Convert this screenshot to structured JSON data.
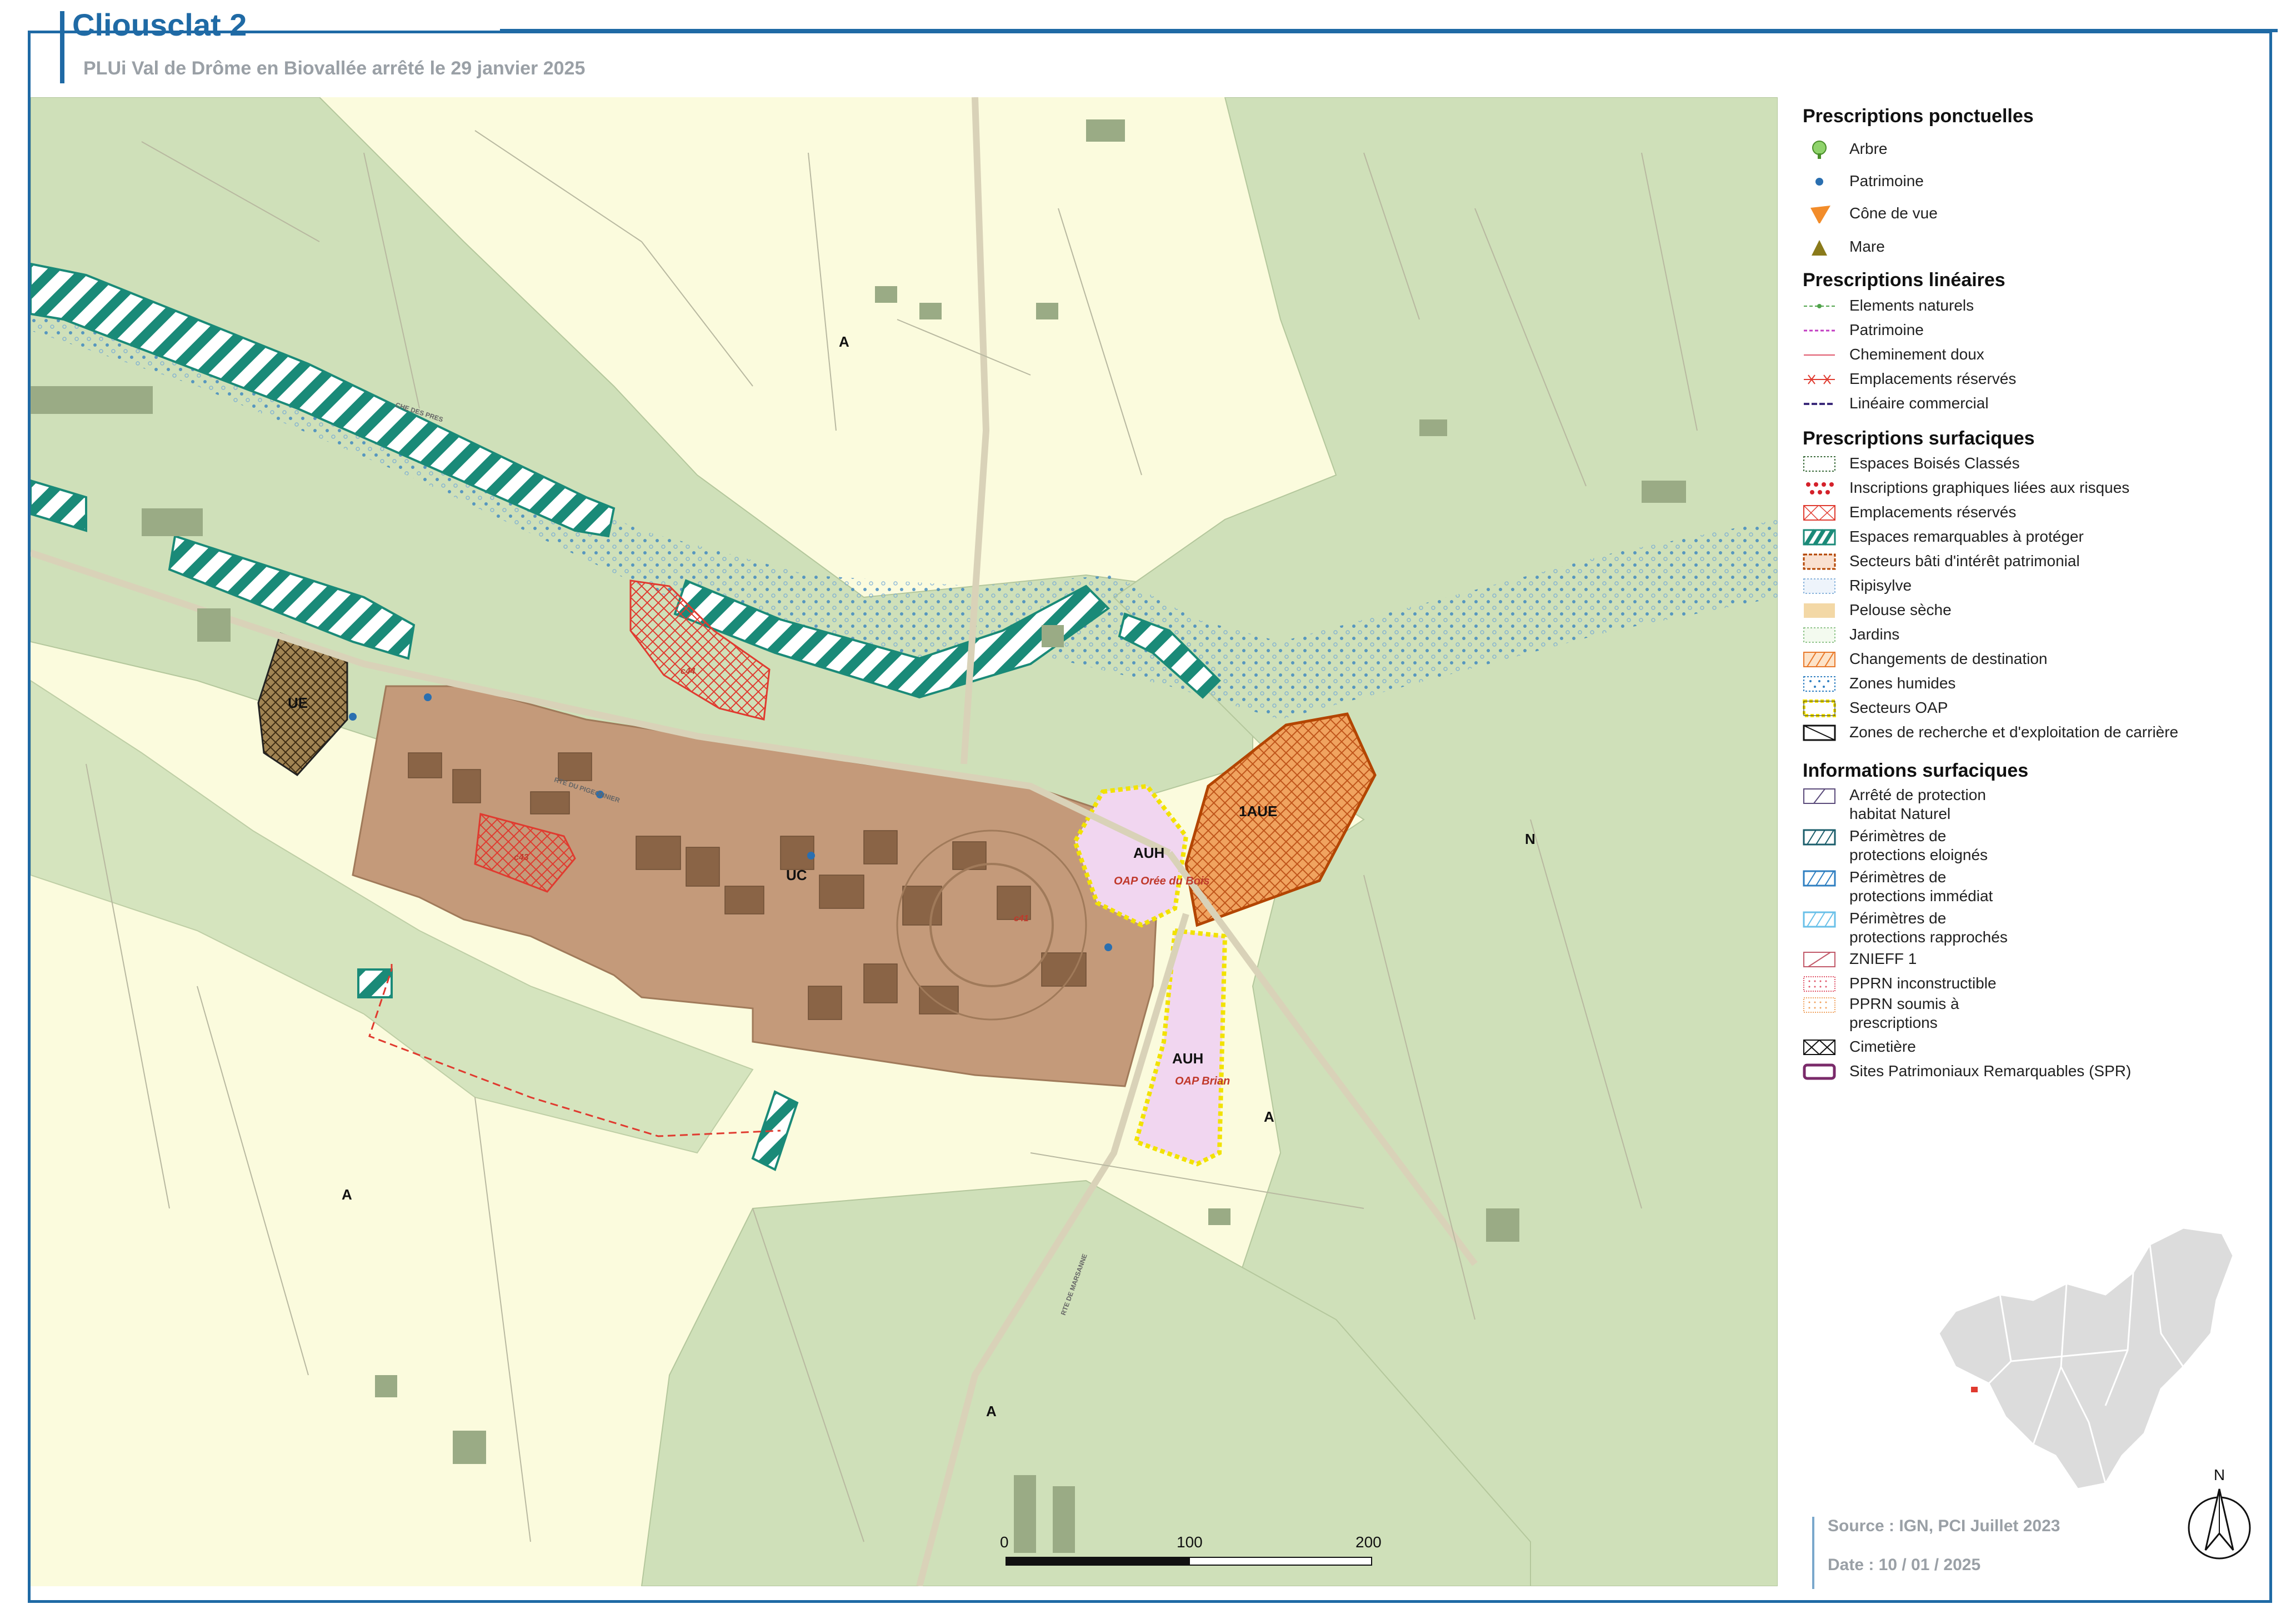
{
  "header": {
    "title": "Cliousclat 2",
    "subtitle": "PLUi Val de Drôme en Biovallée arrêté le 29 janvier 2025"
  },
  "map": {
    "zones": {
      "a1": "A",
      "a2": "A",
      "a3": "A",
      "a4": "A",
      "n": "N",
      "ue1": "UE",
      "ue2": "1AUE",
      "uc": "UC",
      "auh1": "AUH",
      "auh2": "AUH"
    },
    "oap": {
      "oree": "OAP Orée du Bois",
      "brian": "OAP Brian"
    },
    "er": {
      "c44": "c44",
      "c43": "c43",
      "c41": "c41"
    },
    "roads": {
      "che_pres": "CHE DES PRES",
      "route_pigeonnier": "RTE DU PIGEONNIER",
      "rte_marsanne": "RTE DE MARSANNE"
    }
  },
  "legend": {
    "ponctuelles": {
      "title": "Prescriptions ponctuelles",
      "items": [
        "Arbre",
        "Patrimoine",
        "Cône de vue",
        "Mare"
      ]
    },
    "lineaires": {
      "title": "Prescriptions linéaires",
      "items": [
        "Elements naturels",
        "Patrimoine",
        "Cheminement doux",
        "Emplacements réservés",
        "Linéaire commercial"
      ]
    },
    "surfaciques": {
      "title": "Prescriptions surfaciques",
      "items": [
        "Espaces Boisés Classés",
        "Inscriptions graphiques liées aux risques",
        "Emplacements réservés",
        "Espaces remarquables à protéger",
        "Secteurs bâti d'intérêt patrimonial",
        "Ripisylve",
        "Pelouse sèche",
        "Jardins",
        "Changements de destination",
        "Zones humides",
        "Secteurs OAP",
        "Zones de recherche et d'exploitation de carrière"
      ]
    },
    "informations": {
      "title": "Informations surfaciques",
      "items": [
        "Arrêté de protection\nhabitat Naturel",
        "Périmètres de\nprotections eloignés",
        "Périmètres de\nprotections immédiat",
        "Périmètres de\nprotections rapprochés",
        "ZNIEFF 1",
        "PPRN inconstructible",
        "PPRN soumis à\nprescriptions",
        "Cimetière",
        "Sites Patrimoniaux Remarquables (SPR)"
      ]
    }
  },
  "scale": {
    "s0": "0",
    "s1": "100",
    "s2": "200 m"
  },
  "north": "N",
  "footer": {
    "source": "Source : IGN, PCI Juillet 2023",
    "date": "Date : 10 / 01 / 2025"
  },
  "colors": {
    "frame": "#1f6aa5",
    "zone_a": "#fbfbdd",
    "zone_n": "#cfe0b9",
    "zone_u": "#c49a7a",
    "auh": "#f1d6f0",
    "espaces_remarquables": "#1a8a78",
    "er": "#e03a2f",
    "oap": "#f2e200",
    "changement": "#e8792b"
  }
}
